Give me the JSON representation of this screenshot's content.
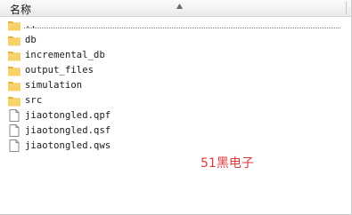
{
  "header": {
    "name_column": "名称"
  },
  "files": [
    {
      "name": "..",
      "type": "folder"
    },
    {
      "name": "db",
      "type": "folder"
    },
    {
      "name": "incremental_db",
      "type": "folder"
    },
    {
      "name": "output_files",
      "type": "folder"
    },
    {
      "name": "simulation",
      "type": "folder"
    },
    {
      "name": "src",
      "type": "folder"
    },
    {
      "name": "jiaotongled.qpf",
      "type": "file"
    },
    {
      "name": "jiaotongled.qsf",
      "type": "file"
    },
    {
      "name": "jiaotongled.qws",
      "type": "file"
    }
  ],
  "watermark": "51黑电子",
  "colors": {
    "folder": "#f5c84c",
    "watermark": "#e0393a"
  }
}
